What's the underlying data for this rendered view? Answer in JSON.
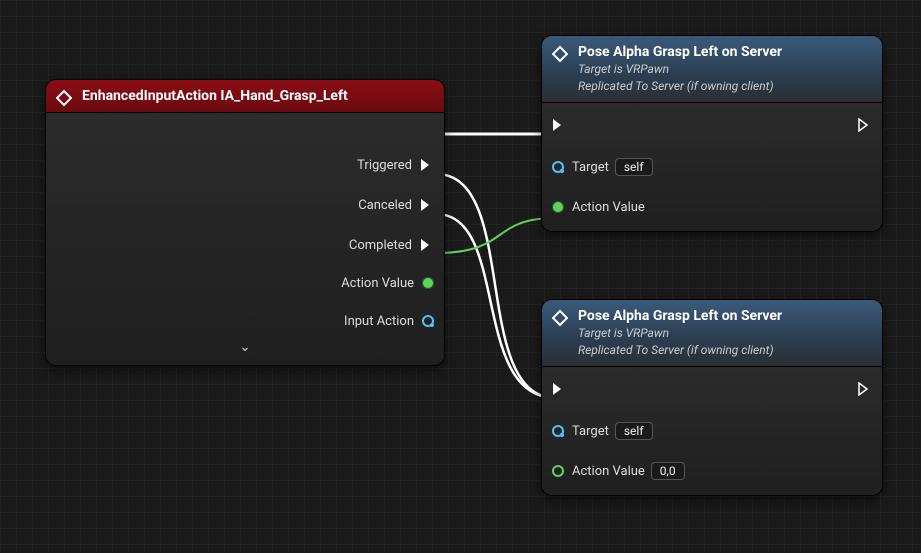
{
  "nodeA": {
    "title": "EnhancedInputAction IA_Hand_Grasp_Left",
    "pins": {
      "triggered": "Triggered",
      "canceled": "Canceled",
      "completed": "Completed",
      "actionValue": "Action Value",
      "inputAction": "Input Action"
    }
  },
  "nodeB": {
    "title": "Pose Alpha Grasp Left on Server",
    "sub1": "Target is VRPawn",
    "sub2": "Replicated To Server (if owning client)",
    "target": "Target",
    "targetVal": "self",
    "actionValue": "Action Value"
  },
  "nodeC": {
    "title": "Pose Alpha Grasp Left on Server",
    "sub1": "Target is VRPawn",
    "sub2": "Replicated To Server (if owning client)",
    "target": "Target",
    "targetVal": "self",
    "actionValue": "Action Value",
    "actionValueDefault": "0,0"
  },
  "expand_glyph": "⌄"
}
